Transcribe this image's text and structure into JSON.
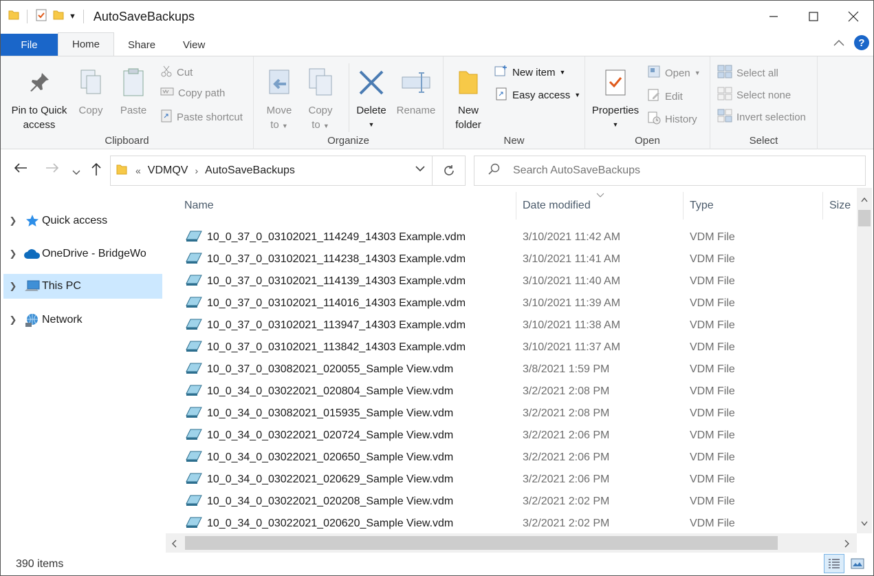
{
  "window": {
    "title": "AutoSaveBackups"
  },
  "tabs": [
    {
      "label": "File"
    },
    {
      "label": "Home"
    },
    {
      "label": "Share"
    },
    {
      "label": "View"
    }
  ],
  "ribbon": {
    "clipboard": {
      "label": "Clipboard",
      "pin": "Pin to Quick",
      "pin2": "access",
      "copy": "Copy",
      "paste": "Paste",
      "cut": "Cut",
      "copy_path": "Copy path",
      "paste_shortcut": "Paste shortcut"
    },
    "organize": {
      "label": "Organize",
      "move": "Move",
      "move2": "to",
      "copy": "Copy",
      "copy2": "to",
      "delete": "Delete",
      "rename": "Rename"
    },
    "new": {
      "label": "New",
      "new_folder": "New",
      "new_folder2": "folder",
      "new_item": "New item",
      "easy_access": "Easy access"
    },
    "open": {
      "label": "Open",
      "properties": "Properties",
      "open": "Open",
      "edit": "Edit",
      "history": "History"
    },
    "select": {
      "label": "Select",
      "select_all": "Select all",
      "select_none": "Select none",
      "invert": "Invert selection"
    }
  },
  "address": {
    "overflow": "«",
    "crumbs": [
      "VDMQV",
      "AutoSaveBackups"
    ]
  },
  "search": {
    "placeholder": "Search AutoSaveBackups"
  },
  "sidebar": {
    "items": [
      {
        "label": "Quick access"
      },
      {
        "label": "OneDrive - BridgeWo"
      },
      {
        "label": "This PC"
      },
      {
        "label": "Network"
      }
    ]
  },
  "columns": {
    "name": "Name",
    "date": "Date modified",
    "type": "Type",
    "size": "Size"
  },
  "files": [
    {
      "name": "10_0_37_0_03102021_114249_14303 Example.vdm",
      "date": "3/10/2021 11:42 AM",
      "type": "VDM File"
    },
    {
      "name": "10_0_37_0_03102021_114238_14303 Example.vdm",
      "date": "3/10/2021 11:41 AM",
      "type": "VDM File"
    },
    {
      "name": "10_0_37_0_03102021_114139_14303 Example.vdm",
      "date": "3/10/2021 11:40 AM",
      "type": "VDM File"
    },
    {
      "name": "10_0_37_0_03102021_114016_14303 Example.vdm",
      "date": "3/10/2021 11:39 AM",
      "type": "VDM File"
    },
    {
      "name": "10_0_37_0_03102021_113947_14303 Example.vdm",
      "date": "3/10/2021 11:38 AM",
      "type": "VDM File"
    },
    {
      "name": "10_0_37_0_03102021_113842_14303 Example.vdm",
      "date": "3/10/2021 11:37 AM",
      "type": "VDM File"
    },
    {
      "name": "10_0_37_0_03082021_020055_Sample View.vdm",
      "date": "3/8/2021 1:59 PM",
      "type": "VDM File"
    },
    {
      "name": "10_0_34_0_03022021_020804_Sample View.vdm",
      "date": "3/2/2021 2:08 PM",
      "type": "VDM File"
    },
    {
      "name": "10_0_34_0_03082021_015935_Sample View.vdm",
      "date": "3/2/2021 2:08 PM",
      "type": "VDM File"
    },
    {
      "name": "10_0_34_0_03022021_020724_Sample View.vdm",
      "date": "3/2/2021 2:06 PM",
      "type": "VDM File"
    },
    {
      "name": "10_0_34_0_03022021_020650_Sample View.vdm",
      "date": "3/2/2021 2:06 PM",
      "type": "VDM File"
    },
    {
      "name": "10_0_34_0_03022021_020629_Sample View.vdm",
      "date": "3/2/2021 2:06 PM",
      "type": "VDM File"
    },
    {
      "name": "10_0_34_0_03022021_020208_Sample View.vdm",
      "date": "3/2/2021 2:02 PM",
      "type": "VDM File"
    },
    {
      "name": "10_0_34_0_03022021_020620_Sample View.vdm",
      "date": "3/2/2021 2:02 PM",
      "type": "VDM File"
    }
  ],
  "status": {
    "count": "390 items"
  },
  "colors": {
    "accent": "#1a66c9",
    "selection": "#cce8ff",
    "ribbon_bg": "#f5f6f7"
  }
}
